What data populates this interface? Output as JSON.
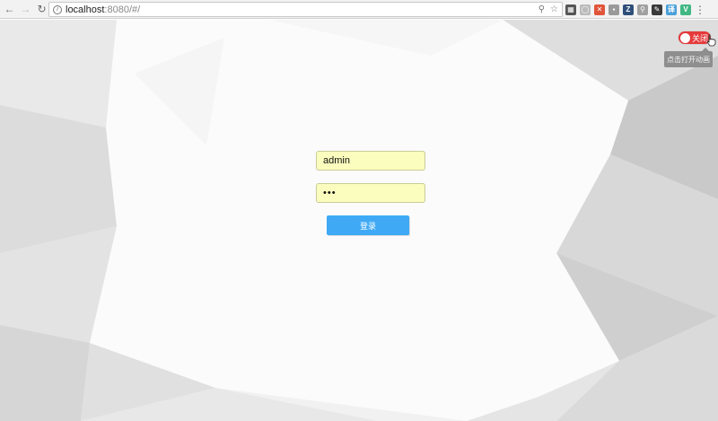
{
  "browser": {
    "url_host": "localhost",
    "url_rest": ":8080/#/",
    "extensions": [
      {
        "name": "qr-code-icon",
        "color": "#555555",
        "glyph": "▦"
      },
      {
        "name": "circle-ext-icon",
        "color": "#bbbbbb",
        "glyph": "◯"
      },
      {
        "name": "red-x-ext-icon",
        "color": "#e0553a",
        "glyph": "✕"
      },
      {
        "name": "gray-ext-icon",
        "color": "#9a9a9a",
        "glyph": "▪"
      },
      {
        "name": "z-ext-icon",
        "color": "#2f4f7a",
        "glyph": "Z"
      },
      {
        "name": "magnifier-ext-icon",
        "color": "#a0a0a0",
        "glyph": "⚲"
      },
      {
        "name": "pen-ext-icon",
        "color": "#3a3a3a",
        "glyph": "✎"
      },
      {
        "name": "translate-ext-icon",
        "color": "#4aa0d8",
        "glyph": "译"
      },
      {
        "name": "vue-ext-icon",
        "color": "#41b883",
        "glyph": "V"
      }
    ]
  },
  "animation_toggle": {
    "label": "关闭",
    "tooltip": "点击打开动画",
    "state": "off",
    "color": "#e5393b"
  },
  "login": {
    "username_value": "admin",
    "password_value": "•••",
    "submit_label": "登录",
    "button_color": "#3fa9f5",
    "field_bg": "#fafdbd"
  }
}
